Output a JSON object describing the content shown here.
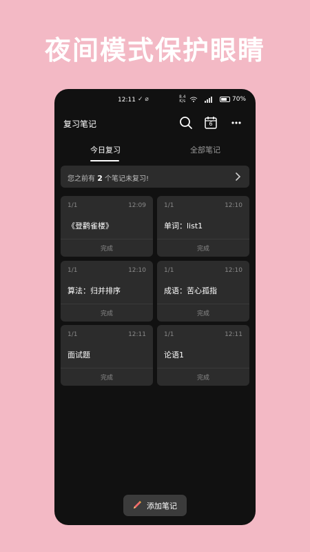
{
  "headline": "夜间模式保护眼睛",
  "status": {
    "time": "12:11",
    "speed_top": "8.4",
    "speed_bottom": "K/s",
    "battery": "70%",
    "battery_level": 0.7
  },
  "app": {
    "title": "复习笔记",
    "calendar_day": "6"
  },
  "tabs": [
    {
      "label": "今日复习",
      "active": true
    },
    {
      "label": "全部笔记",
      "active": false
    }
  ],
  "notice": {
    "prefix": "您之前有",
    "count": "2",
    "suffix": "个笔记未复习!"
  },
  "cards": [
    {
      "counter": "1/1",
      "time": "12:09",
      "title": "《登鹳雀楼》",
      "status": "完成"
    },
    {
      "counter": "1/1",
      "time": "12:10",
      "title": "单词：list1",
      "status": "完成"
    },
    {
      "counter": "1/1",
      "time": "12:10",
      "title": "算法：归并排序",
      "status": "完成"
    },
    {
      "counter": "1/1",
      "time": "12:10",
      "title": "成语：苦心孤指",
      "status": "完成"
    },
    {
      "counter": "1/1",
      "time": "12:11",
      "title": "面试题",
      "status": "完成"
    },
    {
      "counter": "1/1",
      "time": "12:11",
      "title": "论语1",
      "status": "完成"
    }
  ],
  "add_button": {
    "label": "添加笔记"
  },
  "colors": {
    "background": "#f3b9c5",
    "phone": "#111111",
    "card": "#2c2c2c",
    "pencil_primary": "#f06b6b",
    "pencil_secondary": "#f5b43c"
  }
}
